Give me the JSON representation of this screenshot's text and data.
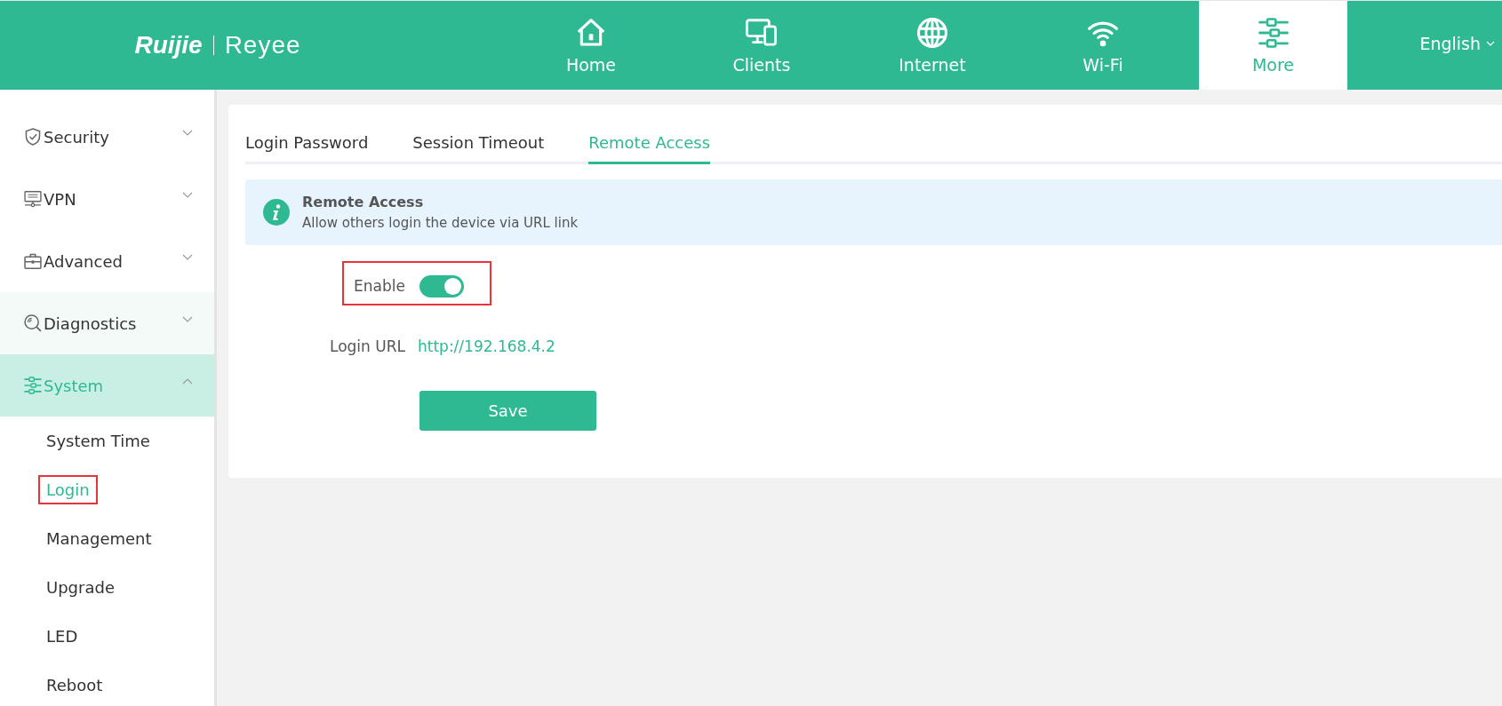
{
  "logo": {
    "brand": "Ruijie",
    "product": "Reyee"
  },
  "nav": [
    {
      "label": "Home",
      "kind": "home",
      "selected": false
    },
    {
      "label": "Clients",
      "kind": "clients",
      "selected": false
    },
    {
      "label": "Internet",
      "kind": "internet",
      "selected": false
    },
    {
      "label": "Wi-Fi",
      "kind": "wifi",
      "selected": false
    },
    {
      "label": "More",
      "kind": "more",
      "selected": true
    }
  ],
  "language": "English",
  "sidebar": {
    "items": [
      {
        "label": "Security",
        "kind": "security",
        "expanded": false,
        "selected": false,
        "hovered": false
      },
      {
        "label": "VPN",
        "kind": "vpn",
        "expanded": false,
        "selected": false,
        "hovered": false
      },
      {
        "label": "Advanced",
        "kind": "advanced",
        "expanded": false,
        "selected": false,
        "hovered": false
      },
      {
        "label": "Diagnostics",
        "kind": "diagnostics",
        "expanded": false,
        "selected": false,
        "hovered": true
      },
      {
        "label": "System",
        "kind": "system",
        "expanded": true,
        "selected": true,
        "hovered": false,
        "children": [
          {
            "label": "System Time",
            "selected": false,
            "highlighted": false
          },
          {
            "label": "Login",
            "selected": true,
            "highlighted": true
          },
          {
            "label": "Management",
            "selected": false,
            "highlighted": false
          },
          {
            "label": "Upgrade",
            "selected": false,
            "highlighted": false
          },
          {
            "label": "LED",
            "selected": false,
            "highlighted": false
          },
          {
            "label": "Reboot",
            "selected": false,
            "highlighted": false
          }
        ]
      }
    ]
  },
  "tabs": [
    {
      "label": "Login Password",
      "selected": false
    },
    {
      "label": "Session Timeout",
      "selected": false
    },
    {
      "label": "Remote Access",
      "selected": true
    }
  ],
  "notice": {
    "title": "Remote Access",
    "text": "Allow others login the device via URL link"
  },
  "form": {
    "enable": {
      "label": "Enable",
      "on": true,
      "highlighted": true
    },
    "login_url": {
      "label": "Login URL",
      "value": "http://192.168.4.2"
    },
    "save": "Save"
  }
}
